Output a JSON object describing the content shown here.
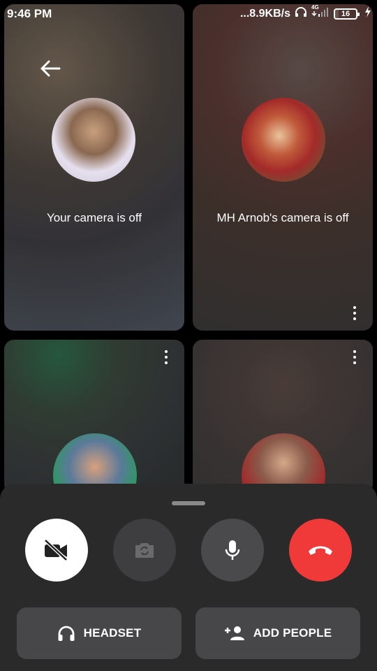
{
  "status_bar": {
    "time": "9:46 PM",
    "net_speed": "...8.9KB/s",
    "network_type": "4G",
    "battery": "16",
    "battery_level": 0.16,
    "icons": [
      "headphones-icon",
      "signal-icon",
      "battery-icon",
      "charging-icon"
    ]
  },
  "tiles": [
    {
      "caption": "Your camera is off",
      "has_back": true,
      "has_more": false
    },
    {
      "caption": "MH Arnob's camera is off",
      "has_back": false,
      "has_more": true
    },
    {
      "caption": "",
      "has_back": false,
      "has_more": true
    },
    {
      "caption": "",
      "has_back": false,
      "has_more": true
    }
  ],
  "controls": {
    "camera_icon": "video-off-icon",
    "flip_icon": "camera-flip-icon",
    "mic_icon": "microphone-icon",
    "end_icon": "end-call-icon",
    "colors": {
      "end_call": "#f03a3a",
      "camera_active": "#ffffff",
      "button_dark": "#4a4a4c",
      "sheet": "#2a2a2b"
    }
  },
  "actions": {
    "headset_label": "HEADSET",
    "add_people_label": "ADD PEOPLE"
  }
}
